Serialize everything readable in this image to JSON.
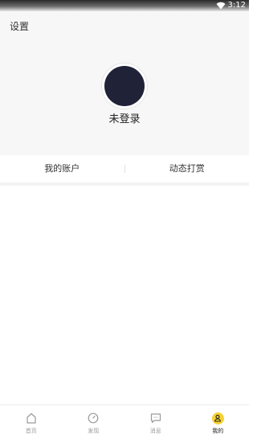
{
  "status_bar": {
    "time": "3:12",
    "icons": [
      "wifi-icon"
    ]
  },
  "header": {
    "settings_label": "设置",
    "login_status": "未登录",
    "colors": {
      "background": "#f7f7f7",
      "avatar": "#202338"
    }
  },
  "account_row": {
    "items": [
      {
        "label": "我的账户"
      },
      {
        "label": "动态打赏"
      }
    ]
  },
  "tab_bar": {
    "active_color": "#f6d230",
    "tabs": [
      {
        "label": "首页",
        "icon": "home-icon",
        "active": false
      },
      {
        "label": "发现",
        "icon": "compass-icon",
        "active": false
      },
      {
        "label": "消息",
        "icon": "message-icon",
        "active": false
      },
      {
        "label": "我的",
        "icon": "user-icon",
        "active": true
      }
    ]
  }
}
